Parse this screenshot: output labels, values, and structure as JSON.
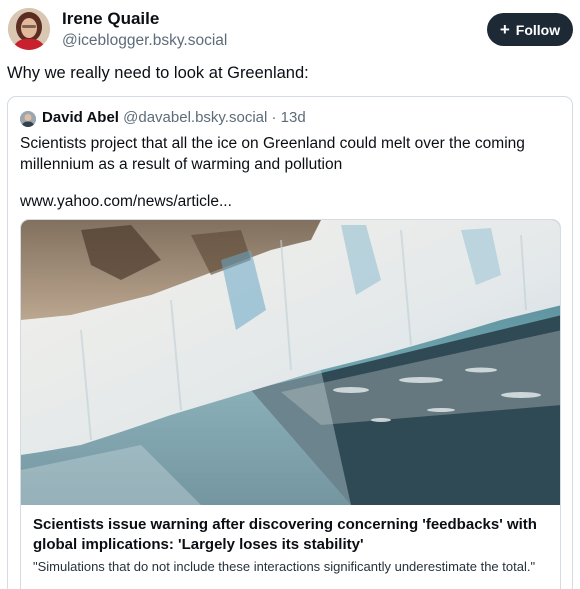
{
  "post": {
    "author": {
      "name": "Irene Quaile",
      "handle": "@iceblogger.bsky.social",
      "avatar_icon": "profile-photo-avatar"
    },
    "follow_button": {
      "label": "Follow",
      "icon": "plus-icon"
    },
    "text": "Why we really need to look at Greenland:"
  },
  "quote": {
    "author_name": "David Abel",
    "author_handle": "@davabel.bsky.social",
    "separator": "·",
    "time": "13d",
    "body": "Scientists project that all the ice on Greenland could melt over the coming millennium as a result of warming and pollution",
    "link_text": "www.yahoo.com/news/article...",
    "card": {
      "image_icon": "glacier-photo",
      "title": "Scientists issue warning after discovering concerning 'feedbacks' with global implications: 'Largely loses its stability'",
      "description": "\"Simulations that do not include these interactions significantly underestimate the total.\""
    }
  },
  "colors": {
    "follow_button_bg": "#1e2936",
    "secondary_text": "#5d6c7a",
    "border": "#d4dbe2"
  }
}
